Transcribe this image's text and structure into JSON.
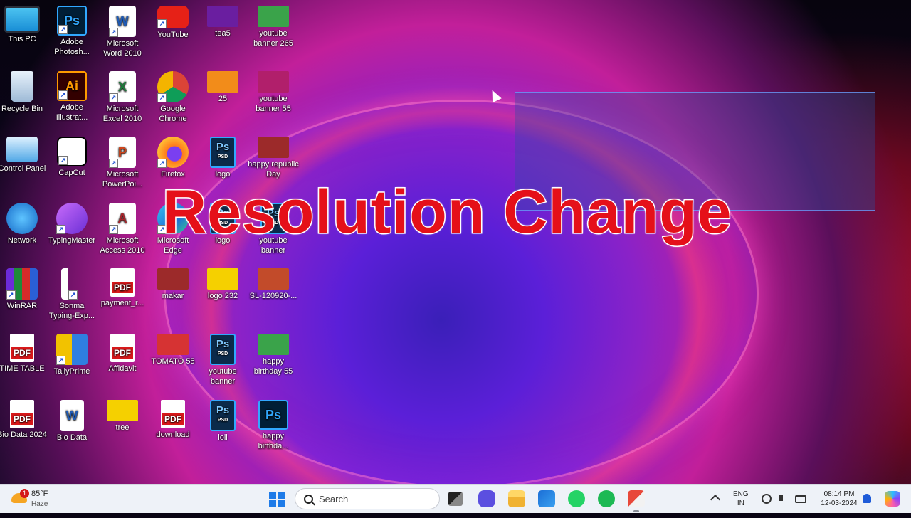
{
  "overlay": {
    "title": "Resolution Change"
  },
  "desktop_icons": [
    {
      "label": "This PC",
      "kind": "monitor",
      "shortcut": false
    },
    {
      "label": "Adobe Photosh...",
      "kind": "ps",
      "shortcut": true
    },
    {
      "label": "Microsoft Word 2010",
      "kind": "word",
      "shortcut": true
    },
    {
      "label": "YouTube",
      "kind": "youtube",
      "shortcut": true
    },
    {
      "label": "tea5",
      "kind": "image",
      "shortcut": false
    },
    {
      "label": "youtube banner 265",
      "kind": "image",
      "shortcut": false
    },
    {
      "label": "Recycle Bin",
      "kind": "recycle",
      "shortcut": false
    },
    {
      "label": "Adobe Illustrat...",
      "kind": "ai",
      "shortcut": true
    },
    {
      "label": "Microsoft Excel 2010",
      "kind": "excel",
      "shortcut": true
    },
    {
      "label": "Google Chrome",
      "kind": "chrome",
      "shortcut": true
    },
    {
      "label": "25",
      "kind": "image",
      "shortcut": false
    },
    {
      "label": "youtube banner 55",
      "kind": "image",
      "shortcut": false
    },
    {
      "label": "Control Panel",
      "kind": "control",
      "shortcut": false
    },
    {
      "label": "CapCut",
      "kind": "capcut",
      "shortcut": true
    },
    {
      "label": "Microsoft PowerPoi...",
      "kind": "ppt",
      "shortcut": true
    },
    {
      "label": "Firefox",
      "kind": "firefox",
      "shortcut": true
    },
    {
      "label": "logo",
      "kind": "psd",
      "shortcut": false
    },
    {
      "label": "happy republic Day",
      "kind": "image",
      "shortcut": false
    },
    {
      "label": "Network",
      "kind": "network",
      "shortcut": false
    },
    {
      "label": "TypingMaster",
      "kind": "typing",
      "shortcut": true
    },
    {
      "label": "Microsoft Access 2010",
      "kind": "access",
      "shortcut": true
    },
    {
      "label": "Microsoft Edge",
      "kind": "edge",
      "shortcut": true
    },
    {
      "label": "logo",
      "kind": "psd",
      "shortcut": false
    },
    {
      "label": "youtube banner",
      "kind": "psd",
      "shortcut": false
    },
    {
      "label": "WinRAR",
      "kind": "winrar",
      "shortcut": true
    },
    {
      "label": "Sonma Typing-Exp...",
      "kind": "sonma",
      "shortcut": true
    },
    {
      "label": "payment_r...",
      "kind": "pdf",
      "shortcut": false
    },
    {
      "label": "makar",
      "kind": "image",
      "shortcut": false
    },
    {
      "label": "logo 232",
      "kind": "image",
      "shortcut": false
    },
    {
      "label": "SL-120920-...",
      "kind": "image",
      "shortcut": false
    },
    {
      "label": "TIME TABLE",
      "kind": "pdf",
      "shortcut": false
    },
    {
      "label": "TallyPrime",
      "kind": "tally",
      "shortcut": true
    },
    {
      "label": "Affidavit",
      "kind": "pdf",
      "shortcut": false
    },
    {
      "label": "TOMATO 55",
      "kind": "image",
      "shortcut": false
    },
    {
      "label": "youtube banner",
      "kind": "psd",
      "shortcut": false
    },
    {
      "label": "happy birthday 55",
      "kind": "image",
      "shortcut": false
    },
    {
      "label": "Bio Data 2024",
      "kind": "pdf",
      "shortcut": false
    },
    {
      "label": "Bio Data",
      "kind": "worddoc",
      "shortcut": false
    },
    {
      "label": "tree",
      "kind": "image",
      "shortcut": false
    },
    {
      "label": "download",
      "kind": "pdf",
      "shortcut": false
    },
    {
      "label": "loii",
      "kind": "psd",
      "shortcut": false
    },
    {
      "label": "happy birthda...",
      "kind": "ps",
      "shortcut": false
    }
  ],
  "icon_text": {
    "ps": "Ps",
    "ai": "Ai",
    "pdf": "PDF",
    "psd": "Ps",
    "psd_sub": "PSD",
    "word": "W",
    "excel": "X",
    "ppt": "P",
    "access": "A"
  },
  "taskbar": {
    "weather": {
      "badge": "1",
      "temp": "85°F",
      "condition": "Haze"
    },
    "search": {
      "placeholder": "Search"
    },
    "language": {
      "line1": "ENG",
      "line2": "IN"
    },
    "clock": {
      "time": "08:14 PM",
      "date": "12-03-2024"
    }
  }
}
